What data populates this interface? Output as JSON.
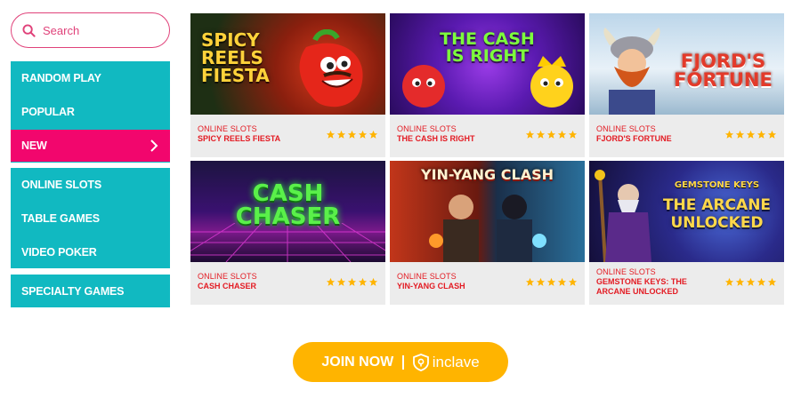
{
  "search": {
    "placeholder": "Search",
    "icon": "search-icon"
  },
  "menu": {
    "group1": [
      "RANDOM PLAY",
      "POPULAR"
    ],
    "active": "NEW",
    "group2": [
      "ONLINE SLOTS",
      "TABLE GAMES",
      "VIDEO POKER"
    ],
    "group3": [
      "SPECIALTY GAMES"
    ]
  },
  "games": [
    {
      "category": "ONLINE SLOTS",
      "name": "SPICY REELS FIESTA",
      "rating": 5,
      "art": "SPICY REELS FIESTA"
    },
    {
      "category": "ONLINE SLOTS",
      "name": "THE CASH IS RIGHT",
      "rating": 5,
      "art": "THE CASH IS RIGHT"
    },
    {
      "category": "ONLINE SLOTS",
      "name": "FJORD'S FORTUNE",
      "rating": 5,
      "art": "FJORD'S FORTUNE"
    },
    {
      "category": "ONLINE SLOTS",
      "name": "CASH CHASER",
      "rating": 5,
      "art": "CASH CHASER"
    },
    {
      "category": "ONLINE SLOTS",
      "name": "YIN-YANG CLASH",
      "rating": 5,
      "art": "YIN-YANG CLASH"
    },
    {
      "category": "ONLINE SLOTS",
      "name": "GEMSTONE KEYS: THE ARCANE UNLOCKED",
      "rating": 5,
      "art": "THE ARCANE UNLOCKED"
    }
  ],
  "join": {
    "label": "JOIN NOW",
    "brand": "inclave"
  },
  "colors": {
    "teal": "#11b9c1",
    "pink": "#f2066d",
    "red": "#e31b23",
    "gold": "#ffb400"
  }
}
